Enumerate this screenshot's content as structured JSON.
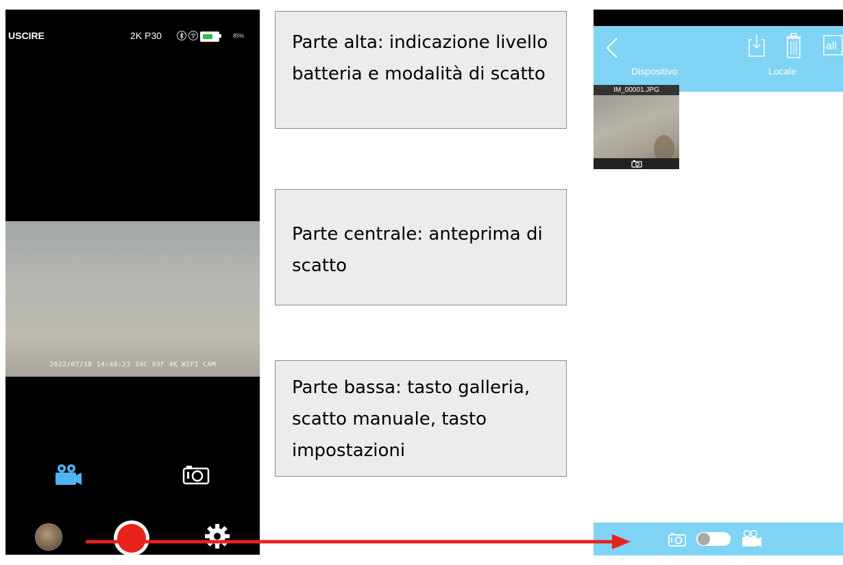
{
  "left_phone": {
    "exit_label": "USCIRE",
    "mode_label": "2K P30",
    "battery_percent": "85%",
    "preview_stamp": "2022/07/18 14:48:23  34C  93F  4K WIFI CAM"
  },
  "callouts": {
    "top": "Parte alta: indicazione livello batteria e modalità di scatto",
    "middle": "Parte centrale: anteprima di scatto",
    "bottom": "Parte bassa: tasto galleria, scatto manuale, tasto impostazioni"
  },
  "right_phone": {
    "tabs": {
      "device": "Dispositivo",
      "local": "Locale"
    },
    "all_label": "all",
    "file_name": "IM_00001.JPG"
  },
  "colors": {
    "accent": "#7fd3f4",
    "record": "#e8231c",
    "video_icon": "#4fb4f0",
    "arrow": "#e8231c"
  },
  "icons": [
    "bluetooth-icon",
    "wifi-icon",
    "battery-icon",
    "video-camera-icon",
    "camera-icon",
    "gallery-thumbnail",
    "record-button",
    "gear-icon",
    "back-chevron-icon",
    "download-icon",
    "trash-icon",
    "select-all-icon",
    "toggle-switch"
  ]
}
